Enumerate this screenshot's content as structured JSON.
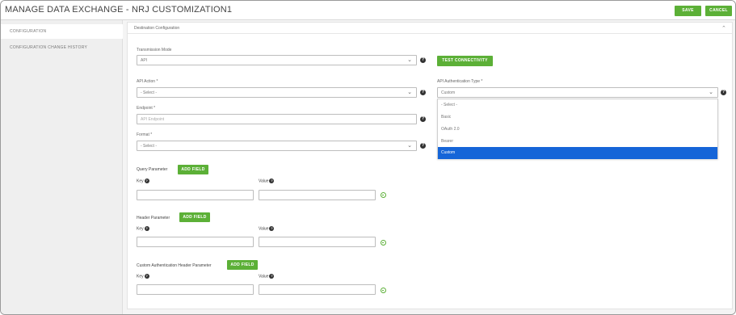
{
  "header": {
    "title": "MANAGE DATA EXCHANGE - NRJ CUSTOMIZATION1",
    "save_label": "SAVE",
    "cancel_label": "CANCEL"
  },
  "sidebar": {
    "items": [
      {
        "label": "CONFIGURATION"
      },
      {
        "label": "CONFIGURATION CHANGE HISTORY"
      }
    ]
  },
  "panel": {
    "title": "Destination Configuration"
  },
  "form": {
    "transmission_mode": {
      "label": "Transmission Mode",
      "value": "API"
    },
    "test_connectivity_label": "TEST CONNECTIVITY",
    "api_action": {
      "label": "API Action *",
      "value": "- Select -"
    },
    "endpoint": {
      "label": "Endpoint *",
      "placeholder": "API Endpoint"
    },
    "format": {
      "label": "Format *",
      "value": "- Select -"
    },
    "api_auth_type": {
      "label": "API Authentication Type *",
      "value": "Custom",
      "options": [
        "- Select -",
        "Basic",
        "OAuth 2.0",
        "Bearer",
        "Custom"
      ],
      "selected_index": 4
    },
    "query_parameter": {
      "label": "Query Parameter",
      "add_label": "ADD FIELD",
      "key_label": "Key",
      "value_label": "Value"
    },
    "header_parameter": {
      "label": "Header Parameter",
      "add_label": "ADD FIELD",
      "key_label": "Key",
      "value_label": "Value"
    },
    "custom_auth_header": {
      "label": "Custom Authentication Header Parameter",
      "add_label": "ADD FIELD",
      "key_label": "Key",
      "value_label": "Value"
    }
  },
  "colors": {
    "accent_green": "#5cb037",
    "selected_blue": "#1565d8"
  }
}
